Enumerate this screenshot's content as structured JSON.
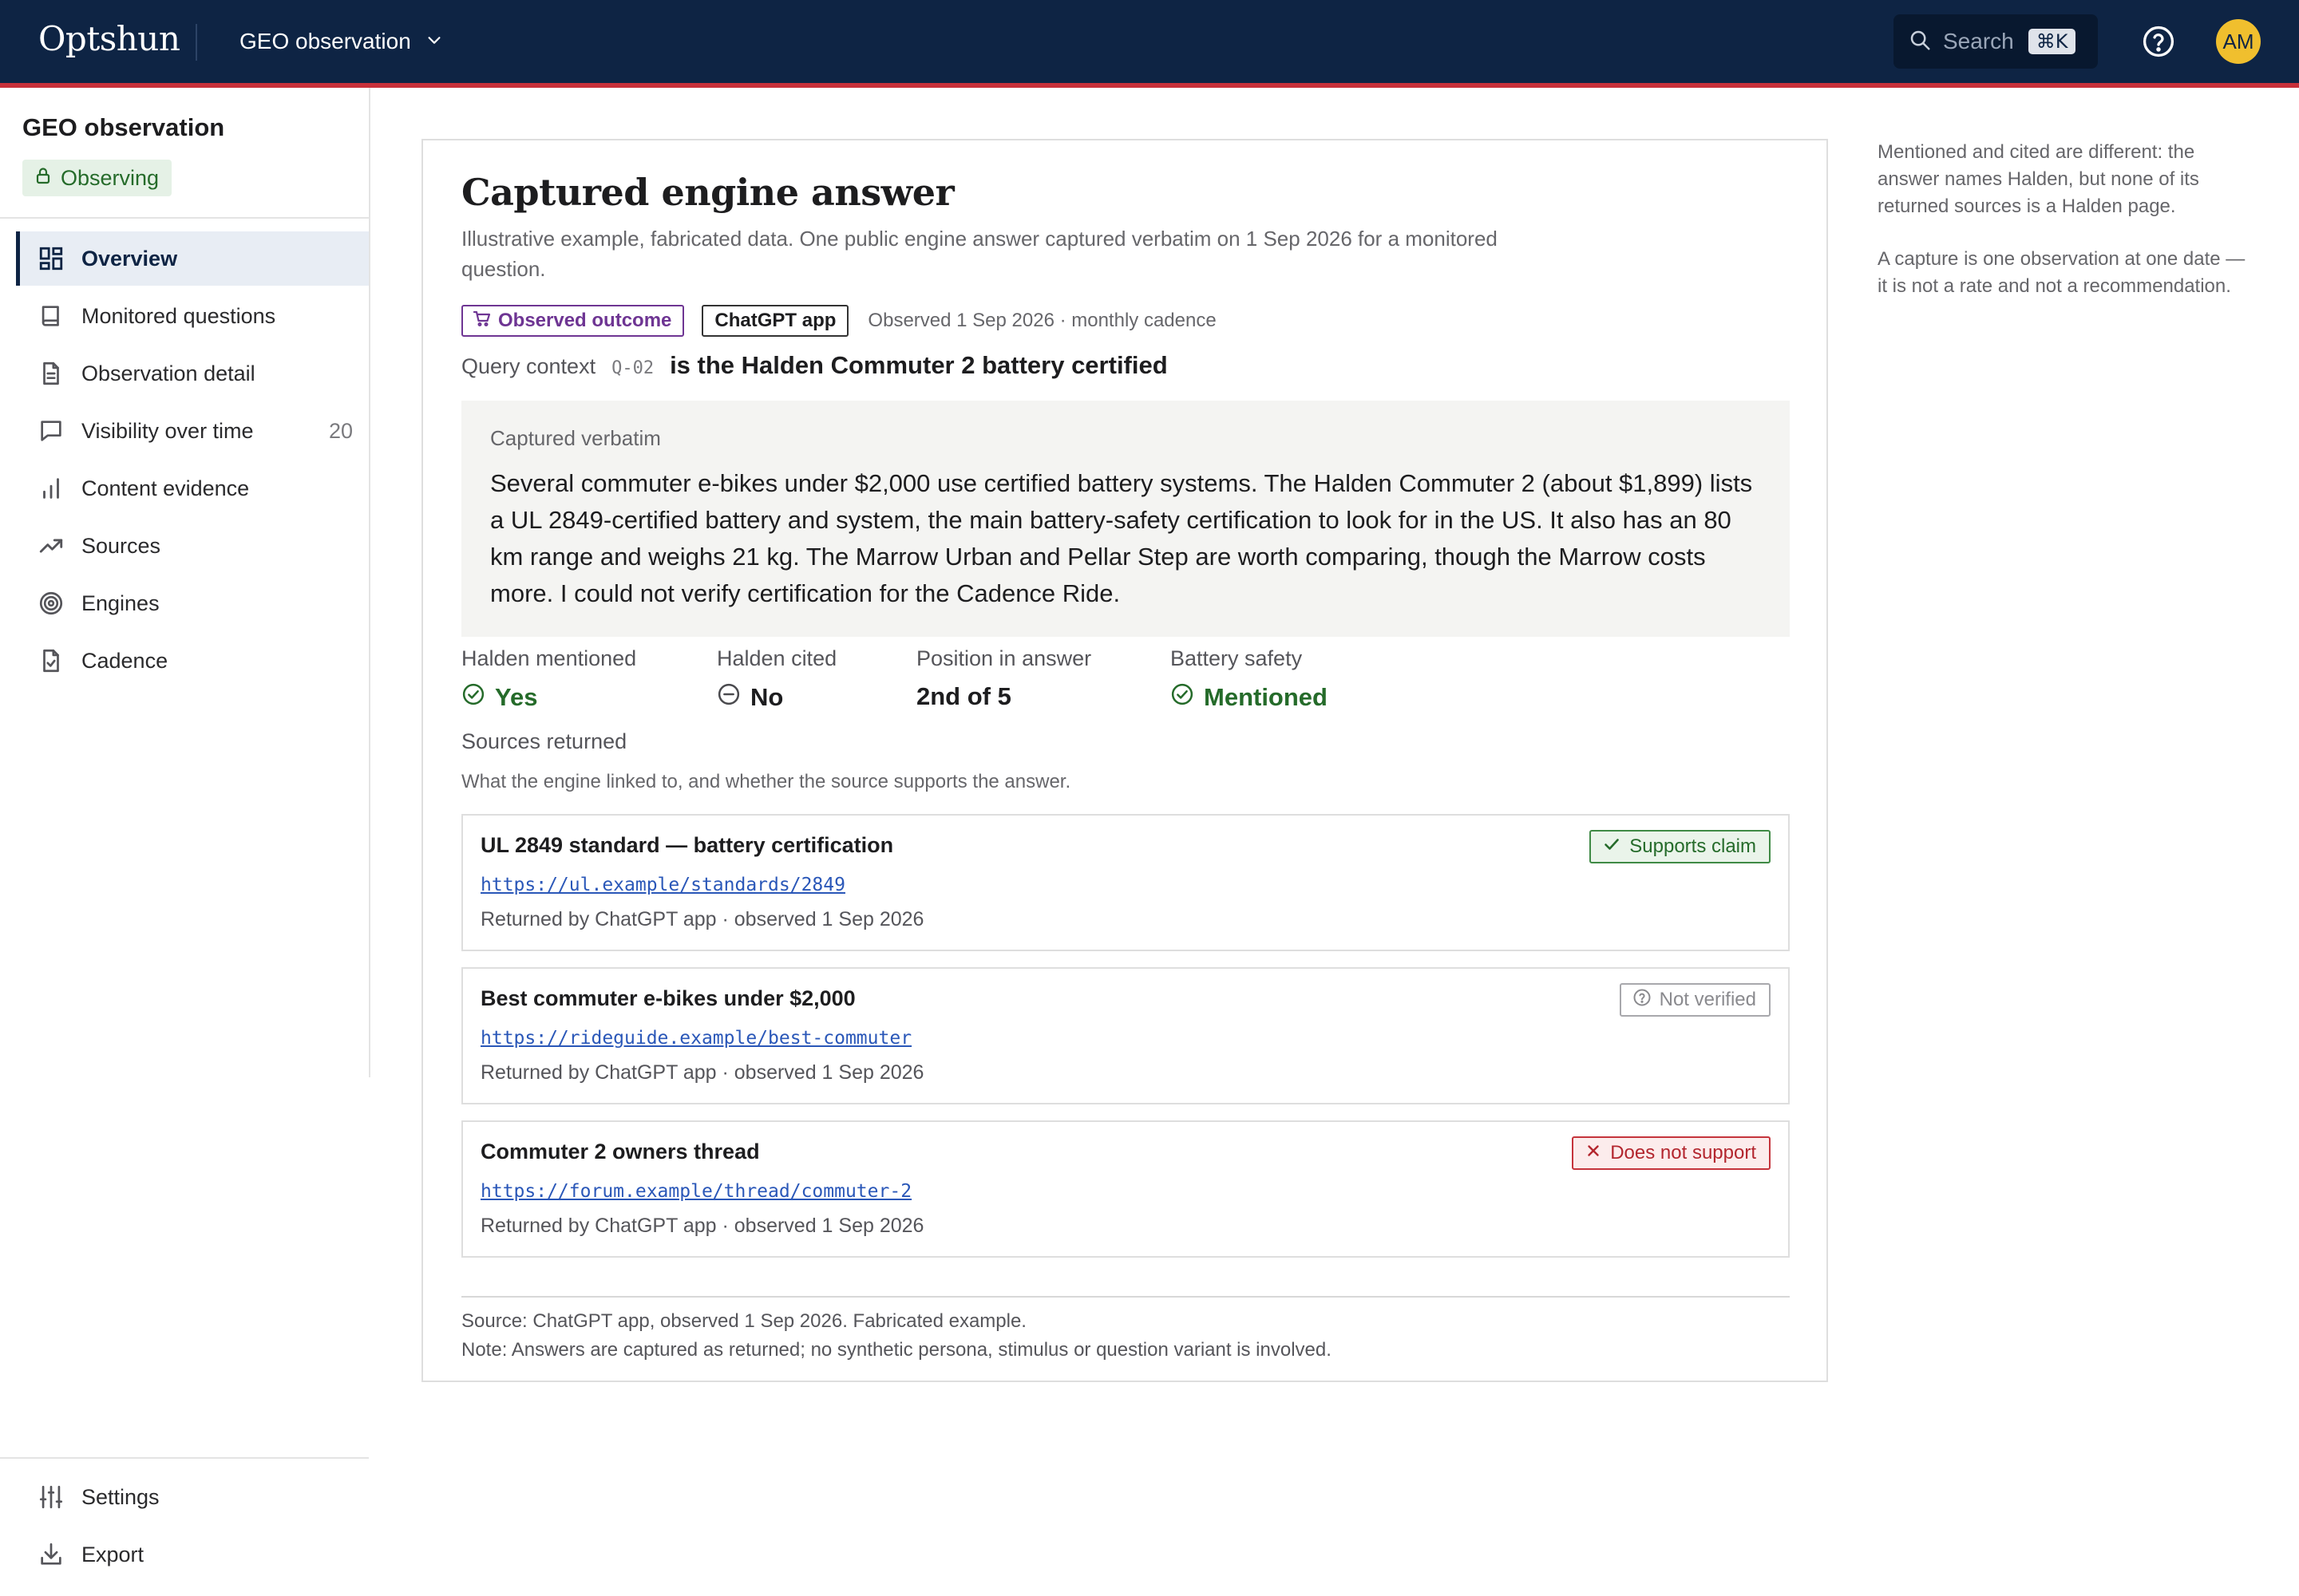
{
  "app": {
    "logo": "Optshun",
    "workspace": "GEO observation",
    "search_label": "Search",
    "search_shortcut": "⌘K",
    "avatar_initials": "AM"
  },
  "sidebar": {
    "title": "GEO observation",
    "status": "Observing",
    "items": [
      {
        "label": "Overview",
        "icon": "grid-icon",
        "active": true
      },
      {
        "label": "Monitored questions",
        "icon": "book-icon"
      },
      {
        "label": "Observation detail",
        "icon": "document-icon"
      },
      {
        "label": "Visibility over time",
        "icon": "chat-bubble-icon",
        "count": "20"
      },
      {
        "label": "Content evidence",
        "icon": "bar-chart-icon"
      },
      {
        "label": "Sources",
        "icon": "trend-up-icon"
      },
      {
        "label": "Engines",
        "icon": "target-icon"
      },
      {
        "label": "Cadence",
        "icon": "file-check-icon"
      }
    ],
    "bottom_items": [
      {
        "label": "Settings",
        "icon": "sliders-icon"
      },
      {
        "label": "Export",
        "icon": "download-icon"
      }
    ]
  },
  "card": {
    "title": "Captured engine answer",
    "subtitle": "Illustrative example, fabricated data. One public engine answer captured verbatim on 1 Sep 2026 for a monitored question.",
    "tag_outcome": "Observed outcome",
    "tag_engine": "ChatGPT app",
    "observed_meta": "Observed 1 Sep 2026 · monthly cadence",
    "query_label": "Query context",
    "query_id": "Q-02",
    "query_text": "is the Halden Commuter 2 battery certified",
    "verbatim_label": "Captured verbatim",
    "verbatim_text": "Several commuter e-bikes under $2,000 use certified battery systems. The Halden Commuter 2 (about $1,899) lists a UL 2849-certified battery and system, the main battery-safety certification to look for in the US. It also has an 80 km range and weighs 21 kg. The Marrow Urban and Pellar Step are worth comparing, though the Marrow costs more. I could not verify certification for the Cadence Ride.",
    "stats": [
      {
        "label": "Halden mentioned",
        "value": "Yes",
        "icon": "check-circle-icon",
        "tone": "green"
      },
      {
        "label": "Halden cited",
        "value": "No",
        "icon": "minus-circle-icon",
        "tone": "dark"
      },
      {
        "label": "Position in answer",
        "value": "2nd of 5",
        "tone": "dark"
      },
      {
        "label": "Battery safety",
        "value": "Mentioned",
        "icon": "check-circle-icon",
        "tone": "green"
      }
    ],
    "sources_title": "Sources returned",
    "sources_subtitle": "What the engine linked to, and whether the source supports the answer.",
    "sources": [
      {
        "title": "UL 2849 standard — battery certification",
        "url": "https://ul.example/standards/2849",
        "meta": "Returned by ChatGPT app · observed 1 Sep 2026",
        "verdict": "Supports claim",
        "verdict_type": "supports",
        "verdict_icon": "check-icon"
      },
      {
        "title": "Best commuter e-bikes under $2,000",
        "url": "https://rideguide.example/best-commuter",
        "meta": "Returned by ChatGPT app · observed 1 Sep 2026",
        "verdict": "Not verified",
        "verdict_type": "unverified",
        "verdict_icon": "question-circle-icon"
      },
      {
        "title": "Commuter 2 owners thread",
        "url": "https://forum.example/thread/commuter-2",
        "meta": "Returned by ChatGPT app · observed 1 Sep 2026",
        "verdict": "Does not support",
        "verdict_type": "contradicts",
        "verdict_icon": "x-icon"
      }
    ],
    "footer_source": "Source: ChatGPT app, observed 1 Sep 2026. Fabricated example.",
    "footer_note": "Note: Answers are captured as returned; no synthetic persona, stimulus or question variant is involved."
  },
  "notes": [
    "Mentioned and cited are different: the answer names Halden, but none of its returned sources is a Halden page.",
    "A capture is one observation at one date — it is not a rate and not a recommendation."
  ],
  "colors": {
    "topbar": "#0e2444",
    "accent_rule": "#c8303a",
    "positive": "#256b2a",
    "outcome_tag": "#6e3593",
    "negative": "#b3262e",
    "link": "#2a57b8",
    "avatar": "#f0bf2e"
  }
}
